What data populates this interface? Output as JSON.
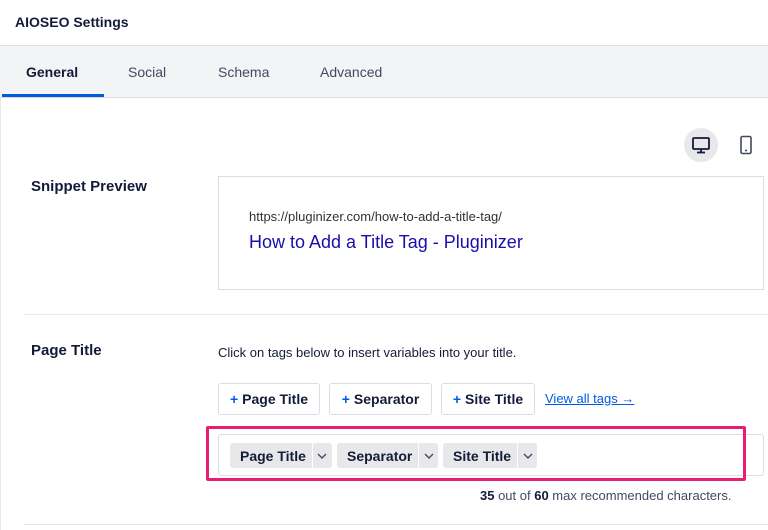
{
  "header": {
    "title": "AIOSEO Settings"
  },
  "tabs": [
    {
      "label": "General",
      "active": true
    },
    {
      "label": "Social",
      "active": false
    },
    {
      "label": "Schema",
      "active": false
    },
    {
      "label": "Advanced",
      "active": false
    }
  ],
  "preview_toggle": {
    "selected": "desktop",
    "icons": [
      "desktop-icon",
      "mobile-icon"
    ]
  },
  "snippet_preview": {
    "label": "Snippet Preview",
    "url": "https://pluginizer.com/how-to-add-a-title-tag/",
    "title": "How to Add a Title Tag - Pluginizer"
  },
  "page_title": {
    "label": "Page Title",
    "help": "Click on tags below to insert variables into your title.",
    "tag_buttons": [
      {
        "plus": "+",
        "label": "Page Title"
      },
      {
        "plus": "+",
        "label": "Separator"
      },
      {
        "plus": "+",
        "label": "Site Title"
      }
    ],
    "view_all": "View all tags →",
    "chips": [
      {
        "label": "Page Title"
      },
      {
        "label": "Separator"
      },
      {
        "label": "Site Title"
      }
    ],
    "count": {
      "current": "35",
      "middle": " out of ",
      "max": "60",
      "suffix": " max recommended characters."
    }
  },
  "colors": {
    "accent": "#005ae0",
    "highlight": "#e91e73",
    "link_title": "#1a0dab"
  }
}
